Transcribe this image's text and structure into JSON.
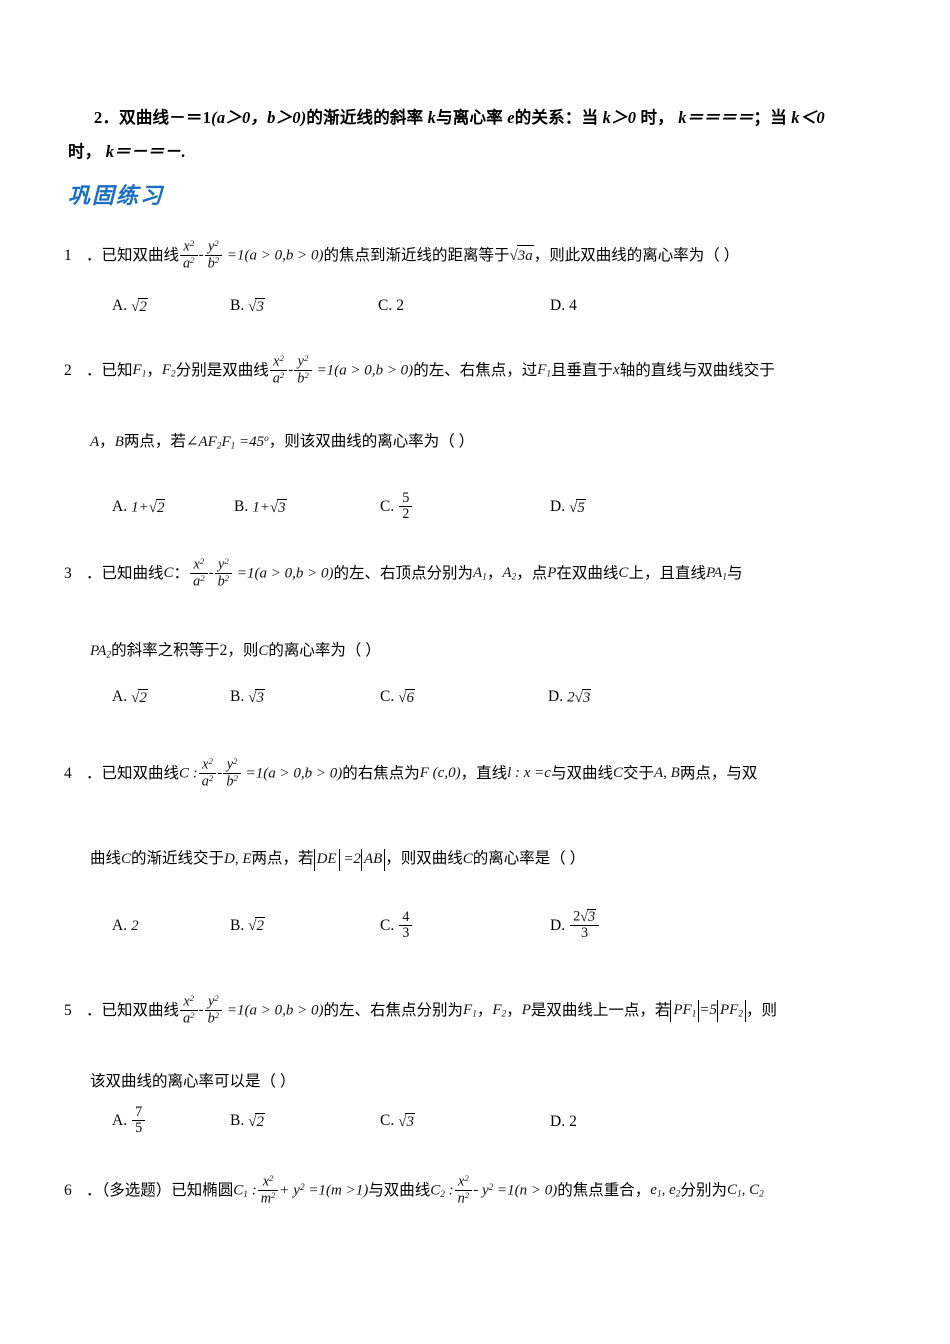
{
  "document": {
    "summary": {
      "number": "2",
      "text_part1": "双曲线",
      "eq1": "－＝1",
      "cond": "(a＞0，b＞0)",
      "text_part2": "的渐近线的斜率",
      "k1": "k",
      "text_part3": "与离心率",
      "e1": "e",
      "text_part4": "的关系：当",
      "k2": "k＞0",
      "text_part5": "时，",
      "k3": "k＝＝＝＝",
      "semi": "；当",
      "k4": "k＜0",
      "text_part6": "时，",
      "k5": "k＝－＝－",
      "period": "."
    },
    "section_heading": "巩固练习",
    "questions": [
      {
        "number": "1",
        "lines": [
          {
            "segments": [
              {
                "type": "text",
                "value": "已知双曲线"
              },
              {
                "type": "frac",
                "num": "x²",
                "den": "a²"
              },
              {
                "type": "text",
                "value": "-"
              },
              {
                "type": "frac",
                "num": "y²",
                "den": "b²"
              },
              {
                "type": "math",
                "value": "=1(a > 0,b > 0)"
              },
              {
                "type": "text",
                "value": "的焦点到渐近线的距离等于"
              },
              {
                "type": "sqrt",
                "value": "3a"
              },
              {
                "type": "text",
                "value": "，则此双曲线的离心率为（    ）"
              }
            ]
          }
        ],
        "options": [
          {
            "label": "A.",
            "value": "√2"
          },
          {
            "label": "B.",
            "value": "√3"
          },
          {
            "label": "C.",
            "value": "2"
          },
          {
            "label": "D.",
            "value": "4"
          }
        ]
      },
      {
        "number": "2",
        "lines": [
          {
            "text": "已知F₁，F₂分别是双曲线 x²/a² - y²/b² =1(a>0,b>0) 的左、右焦点，过F₁且垂直于x轴的直线与双曲线交于"
          },
          {
            "text": "A，B两点，若∠AF₂F₁=45°，则该双曲线的离心率为（    ）"
          }
        ],
        "options": [
          {
            "label": "A.",
            "value": "1+√2"
          },
          {
            "label": "B.",
            "value": "1+√3"
          },
          {
            "label": "C.",
            "value": "5/2"
          },
          {
            "label": "D.",
            "value": "√5"
          }
        ]
      },
      {
        "number": "3",
        "lines": [
          {
            "text": "已知曲线C： x²/a² - y²/b² =1(a>0,b>0)的左、右顶点分别为A₁，A₂，点P在双曲线C上，且直线PA₁与"
          },
          {
            "text": "PA₂的斜率之积等于2，则C的离心率为（    ）"
          }
        ],
        "options": [
          {
            "label": "A.",
            "value": "√2"
          },
          {
            "label": "B.",
            "value": "√3"
          },
          {
            "label": "C.",
            "value": "√6"
          },
          {
            "label": "D.",
            "value": "2√3"
          }
        ]
      },
      {
        "number": "4",
        "lines": [
          {
            "text": "已知双曲线 C: x²/a² - y²/b² =1(a>0,b>0) 的右焦点为F(c,0)，直线l: x=c 与双曲线C交于A,B两点，与双"
          },
          {
            "text": "曲线C的渐近线交于D,E两点，若|DE|=2|AB|，则双曲线C的离心率是（    ）"
          }
        ],
        "options": [
          {
            "label": "A.",
            "value": "2"
          },
          {
            "label": "B.",
            "value": "√2"
          },
          {
            "label": "C.",
            "value": "4/3"
          },
          {
            "label": "D.",
            "value": "2√3/3"
          }
        ]
      },
      {
        "number": "5",
        "lines": [
          {
            "text": "已知双曲线 x²/a² - y²/b² =1(a>0,b>0) 的左、右焦点分别为F₁，F₂，P是双曲线上一点，若|PF₁|=5|PF₂|，则"
          },
          {
            "text": "该双曲线的离心率可以是（    ）"
          }
        ],
        "options": [
          {
            "label": "A.",
            "value": "7/5"
          },
          {
            "label": "B.",
            "value": "√2"
          },
          {
            "label": "C.",
            "value": "√3"
          },
          {
            "label": "D.",
            "value": "2"
          }
        ]
      },
      {
        "number": "6",
        "lines": [
          {
            "text": "（多选题）已知椭圆C₁: x²/m² + y² =1(m>1)与双曲线C₂: x²/n² - y² =1(n>0)的焦点重合，e₁,e₂分别为C₁,C₂"
          }
        ],
        "options": []
      }
    ],
    "labels": {
      "q1_text_a": "已知双曲线",
      "q1_text_b": "的焦点到渐近线的距离等于",
      "q1_text_c": "，则此双曲线的离心率为（    ）",
      "q2_text_a": "已知",
      "q2_text_b": "，",
      "q2_text_c": "分别是双曲线",
      "q2_text_d": "的左、右焦点，过",
      "q2_text_e": "且垂直于",
      "q2_text_f": "轴的直线与双曲线交于",
      "q2_text_g": "，",
      "q2_text_h": "两点，若",
      "q2_text_i": "，则该双曲线的离心率为（    ）",
      "q3_text_a": "已知曲线",
      "q3_text_b": "：",
      "q3_text_c": "的左、右顶点分别为",
      "q3_text_d": "，",
      "q3_text_e": "，点",
      "q3_text_f": "在双曲线",
      "q3_text_g": "上，且直线",
      "q3_text_h": "与",
      "q3_text_i": "的斜率之积等于2，则",
      "q3_text_j": "的离心率为（    ）",
      "q4_text_a": "已知双曲线",
      "q4_text_b": "的右焦点为",
      "q4_text_c": "，直线",
      "q4_text_d": "与双曲线",
      "q4_text_e": "交于",
      "q4_text_f": "两点，与双",
      "q4_text_g": "曲线",
      "q4_text_h": "的渐近线交于",
      "q4_text_i": "两点，若",
      "q4_text_j": "，则双曲线",
      "q4_text_k": "的离心率是（    ）",
      "q5_text_a": "已知双曲线",
      "q5_text_b": "的左、右焦点分别为",
      "q5_text_c": "，",
      "q5_text_d": "，",
      "q5_text_e": "是双曲线上一点，若",
      "q5_text_f": "，则",
      "q5_text_g": "该双曲线的离心率可以是（    ）",
      "q6_text_a": "（多选题）已知椭圆",
      "q6_text_b": "与双曲线",
      "q6_text_c": "的焦点重合，",
      "q6_text_d": "分别为"
    }
  }
}
